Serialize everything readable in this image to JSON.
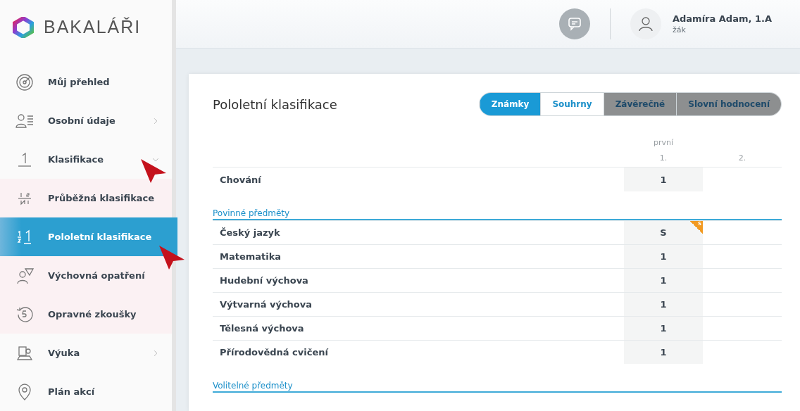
{
  "logo": {
    "text": "BAKALÁŘI"
  },
  "sidebar": {
    "items": [
      {
        "label": "Můj přehled",
        "selected": false,
        "submenu": false
      },
      {
        "label": "Osobní údaje",
        "selected": false,
        "submenu": true,
        "expanded": false
      },
      {
        "label": "Klasifikace",
        "selected": false,
        "submenu": true,
        "expanded": true,
        "children": [
          {
            "label": "Průběžná klasifikace",
            "selected": false
          },
          {
            "label": "Pololetní klasifikace",
            "selected": true
          },
          {
            "label": "Výchovná opatření",
            "selected": false
          },
          {
            "label": "Opravné zkoušky",
            "selected": false
          }
        ]
      },
      {
        "label": "Výuka",
        "selected": false,
        "submenu": true,
        "expanded": false
      },
      {
        "label": "Plán akcí",
        "selected": false,
        "submenu": false
      }
    ]
  },
  "header": {
    "user_name": "Adamíra Adam, 1.A",
    "user_role": "žák"
  },
  "page": {
    "title": "Pololetní klasifikace",
    "tabs": [
      {
        "label": "Známky",
        "selected": true,
        "shaded": false
      },
      {
        "label": "Souhrny",
        "selected": false,
        "shaded": false
      },
      {
        "label": "Závěrečné",
        "selected": false,
        "shaded": true
      },
      {
        "label": "Slovní hodnocení",
        "selected": false,
        "shaded": true
      }
    ]
  },
  "table": {
    "period": "první",
    "columns": [
      "1.",
      "2."
    ],
    "sections": [
      {
        "rows": [
          {
            "subject": "Chování",
            "grade": "1"
          }
        ]
      },
      {
        "title": "Povinné předměty",
        "rows": [
          {
            "subject": "Český jazyk",
            "grade": "S",
            "corner_note": "S"
          },
          {
            "subject": "Matematika",
            "grade": "1"
          },
          {
            "subject": "Hudební výchova",
            "grade": "1"
          },
          {
            "subject": "Výtvarná výchova",
            "grade": "1"
          },
          {
            "subject": "Tělesná výchova",
            "grade": "1"
          },
          {
            "subject": "Přírodovědná cvičení",
            "grade": "1"
          }
        ]
      },
      {
        "title": "Volitelné předměty"
      }
    ]
  }
}
